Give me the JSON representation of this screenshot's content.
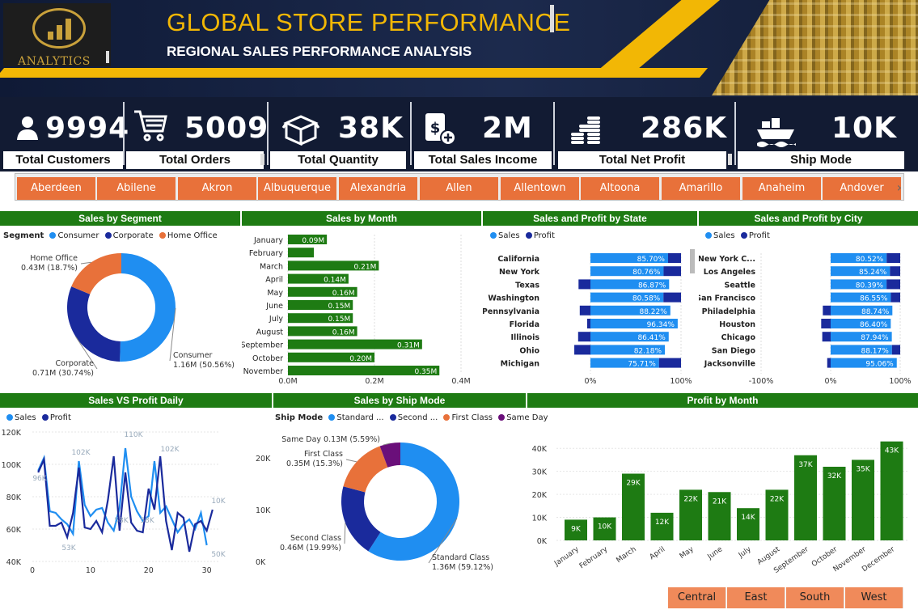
{
  "header": {
    "logo_text": "ANALYTICS",
    "title": "GLOBAL STORE PERFORMANCE",
    "subtitle": "REGIONAL SALES PERFORMANCE ANALYSIS"
  },
  "kpis": [
    {
      "icon": "user-icon",
      "value": "9994",
      "label": "Total Customers"
    },
    {
      "icon": "shopping-cart-icon",
      "value": "5009",
      "label": "Total Orders"
    },
    {
      "icon": "box-icon",
      "value": "38K",
      "label": "Total Quantity"
    },
    {
      "icon": "dollar-document-icon",
      "value": "2M",
      "label": "Total Sales Income"
    },
    {
      "icon": "coin-stack-icon",
      "value": "286K",
      "label": "Total Net Profit"
    },
    {
      "icon": "cargo-ship-icon",
      "value": "10K",
      "label": "Ship Mode"
    }
  ],
  "cities": [
    "Aberdeen",
    "Abilene",
    "Akron",
    "Albuquerque",
    "Alexandria",
    "Allen",
    "Allentown",
    "Altoona",
    "Amarillo",
    "Anaheim",
    "Andover"
  ],
  "sections": {
    "segment": "Sales by Segment",
    "month": "Sales by Month",
    "state": "Sales and Profit by State",
    "city": "Sales and Profit by City",
    "daily": "Sales VS Profit Daily",
    "shipmode": "Sales by Ship Mode",
    "profit_month": "Profit by Month"
  },
  "legends": {
    "segment_title": "Segment",
    "shipmode_title": "Ship Mode",
    "sales": "Sales",
    "profit": "Profit"
  },
  "colors": {
    "header_dark": "#121b33",
    "accent_gold": "#f2b705",
    "green": "#1e7b13",
    "orange": "#e8713a",
    "sales_blue": "#1f8ef1",
    "profit_navy": "#1a2a9c",
    "purple": "#6a0f7a"
  },
  "regions": [
    "Central",
    "East",
    "South",
    "West"
  ],
  "chart_data": [
    {
      "id": "segment",
      "type": "pie",
      "title": "Sales by Segment",
      "series": [
        {
          "name": "Consumer",
          "value": 1.16,
          "label": "Consumer\n1.16M (50.56%)",
          "color": "#1f8ef1"
        },
        {
          "name": "Corporate",
          "value": 0.71,
          "label": "Corporate\n0.71M (30.74%)",
          "color": "#1a2a9c"
        },
        {
          "name": "Home Office",
          "value": 0.43,
          "label": "Home Office\n0.43M (18.7%)",
          "color": "#e8713a"
        }
      ]
    },
    {
      "id": "month",
      "type": "bar",
      "title": "Sales by Month",
      "categories": [
        "January",
        "February",
        "March",
        "April",
        "May",
        "June",
        "July",
        "August",
        "September",
        "October",
        "November"
      ],
      "values": [
        0.09,
        0.06,
        0.21,
        0.14,
        0.16,
        0.15,
        0.15,
        0.16,
        0.31,
        0.2,
        0.35
      ],
      "labels": [
        "0.09M",
        "",
        "0.21M",
        "0.14M",
        "0.16M",
        "0.15M",
        "0.15M",
        "0.16M",
        "0.31M",
        "0.20M",
        "0.35M"
      ],
      "xticks": [
        "0.0M",
        "0.2M",
        "0.4M"
      ],
      "xlim": [
        0,
        0.4
      ]
    },
    {
      "id": "state",
      "type": "bar",
      "title": "Sales and Profit by State",
      "categories": [
        "California",
        "New York",
        "Texas",
        "Washington",
        "Pennsylvania",
        "Florida",
        "Illinois",
        "Ohio",
        "Michigan"
      ],
      "sales_pct": [
        85.7,
        80.76,
        86.87,
        80.58,
        88.22,
        96.34,
        86.41,
        82.18,
        75.71
      ],
      "labels": [
        "85.70%",
        "80.76%",
        "86.87%",
        "80.58%",
        "88.22%",
        "96.34%",
        "86.41%",
        "82.18%",
        "75.71%"
      ],
      "profit_pct": [
        14.3,
        19.24,
        -13.13,
        19.42,
        -11.78,
        -3.66,
        -13.59,
        -17.82,
        24.29
      ],
      "xticks": [
        "0%",
        "100%"
      ]
    },
    {
      "id": "city",
      "type": "bar",
      "title": "Sales and Profit by City",
      "categories": [
        "New York C...",
        "Los Angeles",
        "Seattle",
        "San Francisco",
        "Philadelphia",
        "Houston",
        "Chicago",
        "San Diego",
        "Jacksonville"
      ],
      "sales_pct": [
        80.52,
        85.24,
        80.39,
        86.55,
        88.74,
        86.4,
        87.94,
        88.17,
        95.06
      ],
      "labels": [
        "80.52%",
        "85.24%",
        "80.39%",
        "86.55%",
        "88.74%",
        "86.40%",
        "87.94%",
        "88.17%",
        "95.06%"
      ],
      "profit_pct": [
        19.48,
        14.76,
        19.61,
        13.45,
        -11.26,
        -13.6,
        -12.06,
        11.83,
        -4.94
      ],
      "xticks": [
        "-100%",
        "0%",
        "100%"
      ]
    },
    {
      "id": "daily",
      "type": "line",
      "title": "Sales VS Profit Daily",
      "x": [
        1,
        2,
        3,
        4,
        5,
        6,
        7,
        8,
        9,
        10,
        11,
        12,
        13,
        14,
        15,
        16,
        17,
        18,
        19,
        20,
        21,
        22,
        23,
        24,
        25,
        26,
        27,
        28,
        29,
        30,
        31
      ],
      "series": [
        {
          "name": "Sales",
          "color": "#1f8ef1",
          "values": [
            96,
            104,
            71,
            70,
            66,
            63,
            57,
            102,
            75,
            68,
            72,
            73,
            64,
            59,
            73,
            110,
            80,
            71,
            65,
            68,
            102,
            70,
            74,
            66,
            58,
            63,
            66,
            60,
            70,
            50
          ]
        },
        {
          "name": "Profit",
          "color": "#1a2a9c",
          "values": [
            95,
            103,
            62,
            62,
            64,
            55,
            70,
            98,
            61,
            60,
            65,
            58,
            78,
            105,
            59,
            95,
            64,
            59,
            58,
            85,
            72,
            105,
            65,
            47,
            70,
            67,
            46,
            63,
            65,
            59,
            72
          ]
        }
      ],
      "point_labels": [
        "96K",
        "102K",
        "53K",
        "110K",
        "58K",
        "58K",
        "102K",
        "10K",
        "50K"
      ],
      "yticks_left": [
        "120K",
        "100K",
        "80K",
        "60K",
        "40K"
      ],
      "yticks_right": [
        "20K",
        "10K",
        "0K"
      ],
      "xticks": [
        "0",
        "10",
        "20",
        "30"
      ],
      "ylim": [
        40,
        120
      ]
    },
    {
      "id": "shipmode",
      "type": "pie",
      "title": "Sales by Ship Mode",
      "series": [
        {
          "name": "Standard Class",
          "legend": "Standard ...",
          "value": 1.36,
          "label": "Standard Class\n1.36M (59.12%)",
          "color": "#1f8ef1"
        },
        {
          "name": "Second Class",
          "legend": "Second ...",
          "value": 0.46,
          "label": "Second Class\n0.46M (19.99%)",
          "color": "#1a2a9c"
        },
        {
          "name": "First Class",
          "legend": "First Class",
          "value": 0.35,
          "label": "First Class\n0.35M (15.3%)",
          "color": "#e8713a"
        },
        {
          "name": "Same Day",
          "legend": "Same Day",
          "value": 0.13,
          "label": "Same Day 0.13M (5.59%)",
          "color": "#6a0f7a"
        }
      ]
    },
    {
      "id": "profit_month",
      "type": "bar",
      "title": "Profit by Month",
      "categories": [
        "January",
        "February",
        "March",
        "April",
        "May",
        "June",
        "July",
        "August",
        "September",
        "October",
        "November",
        "December"
      ],
      "values": [
        9,
        10,
        29,
        12,
        22,
        21,
        14,
        22,
        37,
        32,
        35,
        43
      ],
      "labels": [
        "9K",
        "10K",
        "29K",
        "12K",
        "22K",
        "21K",
        "14K",
        "22K",
        "37K",
        "32K",
        "35K",
        "43K"
      ],
      "yticks": [
        "40K",
        "30K",
        "20K",
        "10K",
        "0K"
      ],
      "ylim": [
        0,
        45
      ]
    }
  ]
}
